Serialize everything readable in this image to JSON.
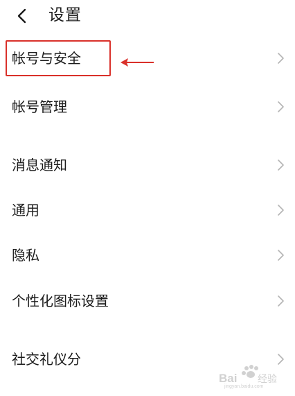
{
  "header": {
    "title": "设置"
  },
  "settings": {
    "items": [
      {
        "label": "帐号与安全"
      },
      {
        "label": "帐号管理"
      },
      {
        "label": "消息通知"
      },
      {
        "label": "通用"
      },
      {
        "label": "隐私"
      },
      {
        "label": "个性化图标设置"
      },
      {
        "label": "社交礼仪分"
      }
    ]
  },
  "watermark": {
    "text": "Baidu 经验",
    "url": "jingyan.baidu.com"
  },
  "colors": {
    "annotation": "#d9302a",
    "chevron": "#b4b4b4",
    "text": "#1b1b1b"
  }
}
